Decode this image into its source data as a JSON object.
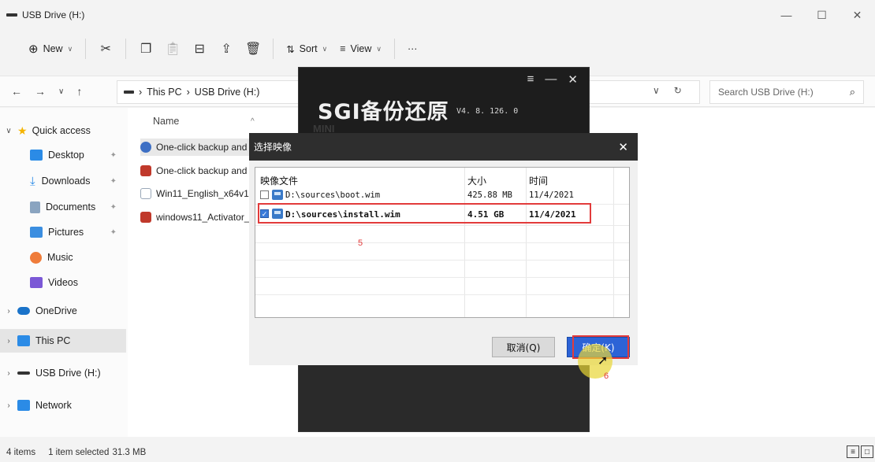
{
  "window": {
    "title": "USB Drive (H:)",
    "controls": [
      "—",
      "☐",
      "✕"
    ]
  },
  "toolbar": {
    "new_label": "New",
    "sort_label": "Sort",
    "view_label": "View",
    "more_label": "···"
  },
  "address": {
    "crumbs": [
      "This PC",
      "USB Drive (H:)"
    ],
    "search_placeholder": "Search USB Drive (H:)"
  },
  "sidebar": {
    "items": [
      {
        "label": "Quick access",
        "icon": "star-icon",
        "color": "#f5b400"
      },
      {
        "label": "Desktop",
        "icon": "desktop-icon",
        "color": "#2b8be6"
      },
      {
        "label": "Downloads",
        "icon": "download-icon",
        "color": "#2b8be6"
      },
      {
        "label": "Documents",
        "icon": "documents-icon",
        "color": "#8aa4c0"
      },
      {
        "label": "Pictures",
        "icon": "pictures-icon",
        "color": "#3b8ee0"
      },
      {
        "label": "Music",
        "icon": "music-icon",
        "color": "#ef7c3a"
      },
      {
        "label": "Videos",
        "icon": "videos-icon",
        "color": "#7b58d6"
      },
      {
        "label": "OneDrive",
        "icon": "onedrive-icon",
        "color": "#1a73c9"
      },
      {
        "label": "This PC",
        "icon": "pc-icon",
        "color": "#2b8be6"
      },
      {
        "label": "USB Drive (H:)",
        "icon": "usb-drive-icon",
        "color": "#333333"
      },
      {
        "label": "Network",
        "icon": "network-icon",
        "color": "#2b8be6"
      }
    ]
  },
  "files": {
    "column_name": "Name",
    "rows": [
      {
        "name": "One-click backup and",
        "icon": "sgi-app-icon",
        "color": "#3d6fc4"
      },
      {
        "name": "One-click backup and",
        "icon": "archive-icon",
        "color": "#c0392b"
      },
      {
        "name": "Win11_English_x64v1",
        "icon": "disc-image-icon",
        "color": "#9aa8b8"
      },
      {
        "name": "windows11_Activator_",
        "icon": "archive-icon",
        "color": "#c0392b"
      }
    ]
  },
  "status": {
    "count": "4 items",
    "selected": "1 item selected",
    "size": "31.3 MB"
  },
  "sgi": {
    "logo": "SGI备份还原",
    "version": "V4. 8. 126. 0",
    "mini": "MINI",
    "controls": [
      "≡",
      "—",
      "✕"
    ]
  },
  "dialog": {
    "title": "选择映像",
    "headers": [
      "映像文件",
      "大小",
      "时间"
    ],
    "rows": [
      {
        "path": "D:\\sources\\boot.wim",
        "size": "425.88 MB",
        "date": "11/4/2021",
        "checked": false
      },
      {
        "path": "D:\\sources\\install.wim",
        "size": "4.51 GB",
        "date": "11/4/2021",
        "checked": true
      }
    ],
    "cancel_label": "取消(Q)",
    "ok_label": "确定(K)",
    "step5": "5",
    "step6": "6"
  }
}
